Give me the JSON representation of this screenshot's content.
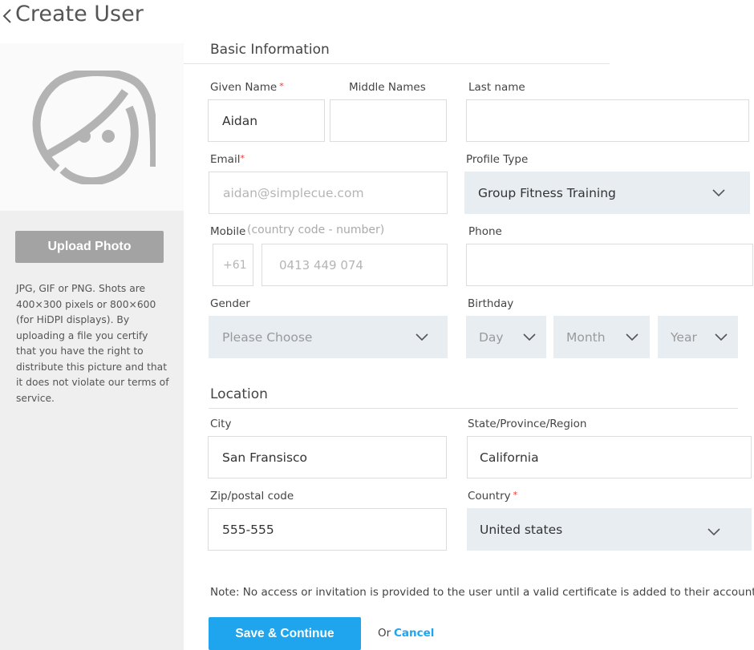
{
  "header": {
    "title": "Create User",
    "back_icon": "chevron-left-icon"
  },
  "sidebar": {
    "avatar_icon": "user-avatar-placeholder-icon",
    "upload_label": "Upload Photo",
    "help_text": "JPG, GIF or PNG. Shots are 400×300 pixels or 800×600 (for HiDPI displays). By uploading a file you certify that you have the right to distribute this picture and that it does not violate our terms of service."
  },
  "basic": {
    "section_title": "Basic Information",
    "given_name": {
      "label": "Given Name",
      "required": "*",
      "value": "Aidan"
    },
    "middle_names": {
      "label": "Middle Names",
      "value": ""
    },
    "last_name": {
      "label": "Last name",
      "value": ""
    },
    "email": {
      "label": "Email",
      "required": "*",
      "placeholder": "aidan@simplecue.com"
    },
    "profile_type": {
      "label": "Profile Type",
      "value": "Group Fitness Training"
    },
    "mobile": {
      "label": "Mobile",
      "hint": "(country code - number)",
      "country_code": "+61",
      "placeholder": "0413 449 074"
    },
    "phone": {
      "label": "Phone",
      "value": ""
    },
    "gender": {
      "label": "Gender",
      "placeholder": "Please Choose"
    },
    "birthday": {
      "label": "Birthday",
      "day": "Day",
      "month": "Month",
      "year": "Year"
    }
  },
  "location": {
    "section_title": "Location",
    "city": {
      "label": "City",
      "value": "San Fransisco"
    },
    "state": {
      "label": "State/Province/Region",
      "value": "California"
    },
    "zip": {
      "label": "Zip/postal code",
      "value": "555-555"
    },
    "country": {
      "label": "Country",
      "required": "*",
      "value": "United states"
    }
  },
  "footer": {
    "note": "Note: No access or invitation is provided to the user until a valid certificate is added to their account.",
    "save_label": "Save & Continue",
    "or_label": "Or",
    "cancel_label": "Cancel"
  },
  "colors": {
    "accent": "#1ea5ee",
    "required": "#e53935",
    "select_bg": "#e8edf1",
    "upload_button": "#a3a3a3"
  }
}
